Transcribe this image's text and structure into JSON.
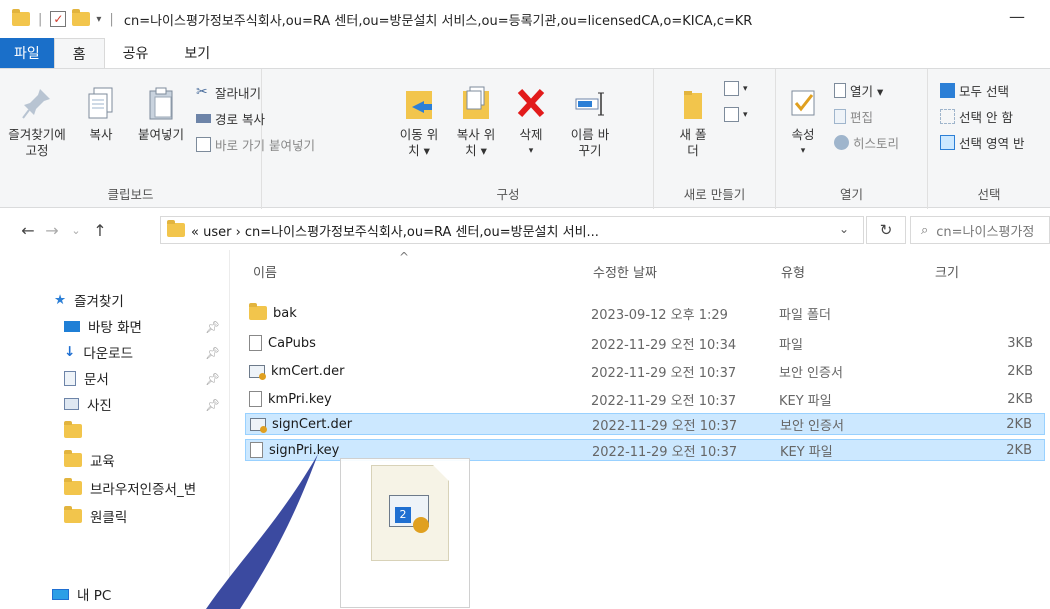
{
  "window": {
    "title": "cn=나이스평가정보주식회사,ou=RA 센터,ou=방문설치 서비스,ou=등록기관,ou=licensedCA,o=KICA,c=KR",
    "minimize_glyph": "—"
  },
  "tabs": [
    {
      "label": "파일"
    },
    {
      "label": "홈"
    },
    {
      "label": "공유"
    },
    {
      "label": "보기"
    }
  ],
  "ribbon": {
    "clipboard": {
      "label": "클립보드",
      "pin": "즐겨찾기에 고정",
      "copy": "복사",
      "paste": "붙여넣기",
      "cut": "잘라내기",
      "copy_path": "경로 복사",
      "paste_shortcut": "바로 가기 붙여넣기"
    },
    "organize": {
      "label": "구성",
      "move_to": "이동 위치 ▾",
      "copy_to": "복사 위치 ▾",
      "delete": "삭제",
      "rename": "이름 바꾸기"
    },
    "new": {
      "label": "새로 만들기",
      "new_folder": "새 폴더"
    },
    "open": {
      "label": "열기",
      "properties": "속성",
      "open": "열기 ▾",
      "edit": "편집",
      "history": "히스토리"
    },
    "select": {
      "label": "선택",
      "select_all": "모두 선택",
      "select_none": "선택 안 함",
      "invert": "선택 영역 반"
    }
  },
  "address": {
    "path": "« user  ›  cn=나이스평가정보주식회사,ou=RA 센터,ou=방문설치 서비...",
    "search_placeholder": "cn=나이스평가정"
  },
  "nav": {
    "items": [
      {
        "label": "즐겨찾기"
      },
      {
        "label": "바탕 화면"
      },
      {
        "label": "다운로드"
      },
      {
        "label": "문서"
      },
      {
        "label": "사진"
      },
      {
        "label": ""
      },
      {
        "label": "교육"
      },
      {
        "label": "브라우저인증서_변"
      },
      {
        "label": "원클릭"
      },
      {
        "label": "내 PC"
      }
    ]
  },
  "columns": {
    "name": "이름",
    "date": "수정한 날짜",
    "type": "유형",
    "size": "크기"
  },
  "files": [
    {
      "name": "bak",
      "date": "2023-09-12 오후 1:29",
      "type": "파일 폴더",
      "size": "",
      "icon": "folder",
      "selected": false
    },
    {
      "name": "CaPubs",
      "date": "2022-11-29 오전 10:34",
      "type": "파일",
      "size": "3KB",
      "icon": "file",
      "selected": false
    },
    {
      "name": "kmCert.der",
      "date": "2022-11-29 오전 10:37",
      "type": "보안 인증서",
      "size": "2KB",
      "icon": "certificate",
      "selected": false
    },
    {
      "name": "kmPri.key",
      "date": "2022-11-29 오전 10:37",
      "type": "KEY 파일",
      "size": "2KB",
      "icon": "file",
      "selected": false
    },
    {
      "name": "signCert.der",
      "date": "2022-11-29 오전 10:37",
      "type": "보안 인증서",
      "size": "2KB",
      "icon": "certificate",
      "selected": true
    },
    {
      "name": "signPri.key",
      "date": "2022-11-29 오전 10:37",
      "type": "KEY 파일",
      "size": "2KB",
      "icon": "file",
      "selected": true
    }
  ],
  "drag": {
    "count": "2"
  },
  "colors": {
    "accent": "#1a6fc9",
    "selection": "#cce8ff",
    "folder": "#f2c54c",
    "arc": "#3b4aa0"
  }
}
